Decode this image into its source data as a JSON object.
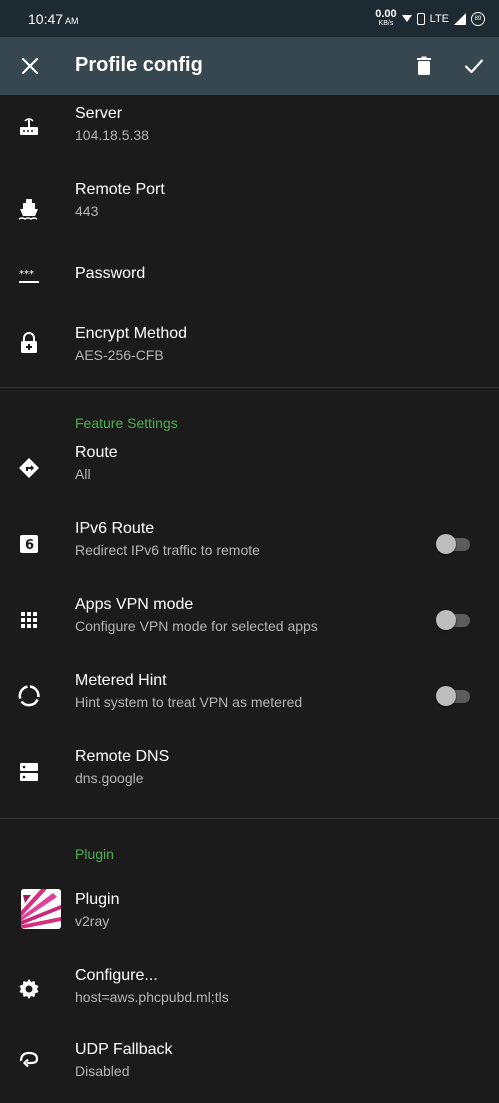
{
  "status_bar": {
    "time": "10:47",
    "ampm": "AM",
    "speed_value": "0.00",
    "speed_unit": "KB/s",
    "network": "LTE",
    "battery": "89"
  },
  "app_bar": {
    "title": "Profile config"
  },
  "items_top": [
    {
      "title": "Server",
      "summary": "104.18.5.38",
      "icon": "router-icon"
    },
    {
      "title": "Remote Port",
      "summary": "443",
      "icon": "ship-icon"
    },
    {
      "title": "Password",
      "summary": "",
      "icon": "password-icon"
    },
    {
      "title": "Encrypt Method",
      "summary": "AES-256-CFB",
      "icon": "lock-icon"
    }
  ],
  "feature_settings": {
    "header": "Feature Settings",
    "items": [
      {
        "title": "Route",
        "summary": "All",
        "icon": "directions-icon"
      },
      {
        "title": "IPv6 Route",
        "summary": "Redirect IPv6 traffic to remote",
        "icon": "ipv6-icon",
        "toggle": false
      },
      {
        "title": "Apps VPN mode",
        "summary": "Configure VPN mode for selected apps",
        "icon": "apps-grid-icon",
        "toggle": false
      },
      {
        "title": "Metered Hint",
        "summary": "Hint system to treat VPN as metered",
        "icon": "data-usage-icon",
        "toggle": false
      },
      {
        "title": "Remote DNS",
        "summary": "dns.google",
        "icon": "dns-icon"
      }
    ]
  },
  "plugin_section": {
    "header": "Plugin",
    "items": [
      {
        "title": "Plugin",
        "summary": "v2ray",
        "icon": "v2ray-logo-icon"
      },
      {
        "title": "Configure...",
        "summary": "host=aws.phcpubd.ml;tls",
        "icon": "settings-gear-icon"
      },
      {
        "title": "UDP Fallback",
        "summary": "Disabled",
        "icon": "udp-fallback-icon"
      }
    ]
  },
  "colors": {
    "background": "#1b1b1b",
    "app_bar": "#37474f",
    "status_bar": "#1e2a31",
    "accent": "#4caf50"
  }
}
